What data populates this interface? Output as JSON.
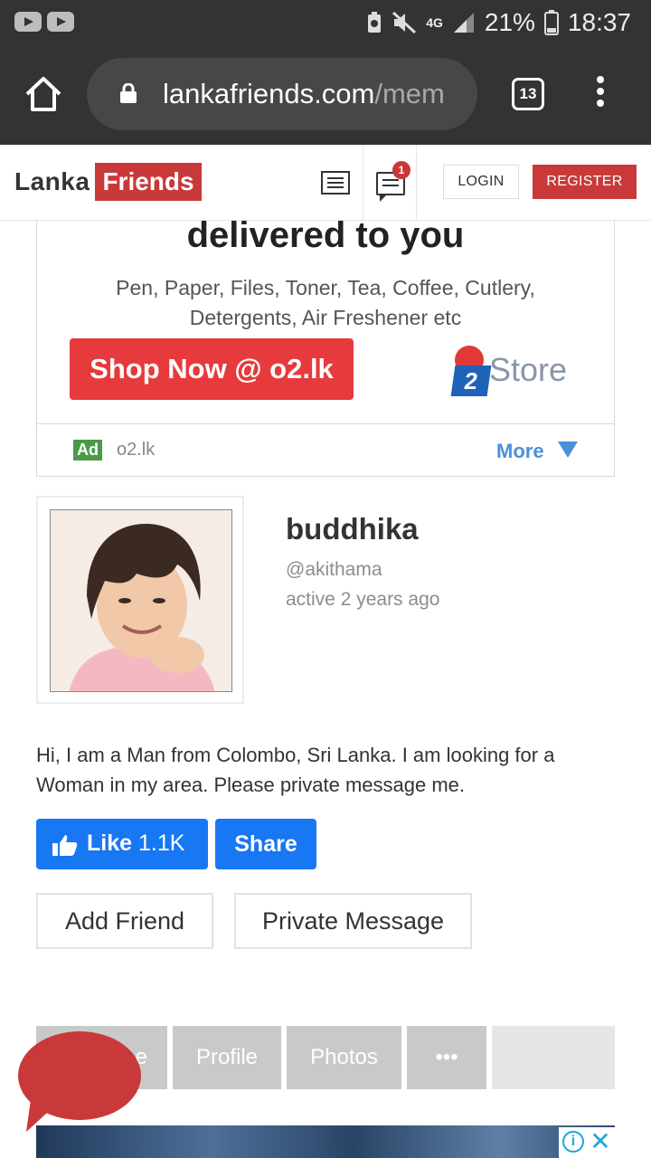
{
  "status_bar": {
    "network": "4G",
    "battery": "21%",
    "time": "18:37"
  },
  "browser": {
    "url_host": "lankafriends.com",
    "url_path": "/mem",
    "tab_count": "13"
  },
  "header": {
    "logo_part1": "Lanka",
    "logo_part2": "Friends",
    "notification_count": "1",
    "login_label": "LOGIN",
    "register_label": "REGISTER"
  },
  "ad": {
    "headline": "delivered to you",
    "copy_line1": "Pen, Paper, Files, Toner, Tea, Coffee, Cutlery,",
    "copy_line2": "Detergents, Air Freshener etc",
    "cta": "Shop Now @ o2.lk",
    "brand_two": "2",
    "brand_store": "Store",
    "tag": "Ad",
    "domain": "o2.lk",
    "more_label": "More"
  },
  "profile": {
    "name": "buddhika",
    "handle": "@akithama",
    "last_active": "active 2 years ago",
    "bio": "Hi, I am a Man from Colombo, Sri Lanka. I am looking for a Woman in my area. Please private message me."
  },
  "social": {
    "like_label": "Like",
    "like_count": "1.1K",
    "share_label": "Share"
  },
  "actions": {
    "add_friend": "Add Friend",
    "private_message": "Private Message"
  },
  "tabs": [
    {
      "label": "e"
    },
    {
      "label": "Profile"
    },
    {
      "label": "Photos"
    },
    {
      "label": "•••"
    }
  ],
  "bottom_ad": {
    "info_icon": "i",
    "close_icon": "✕"
  }
}
